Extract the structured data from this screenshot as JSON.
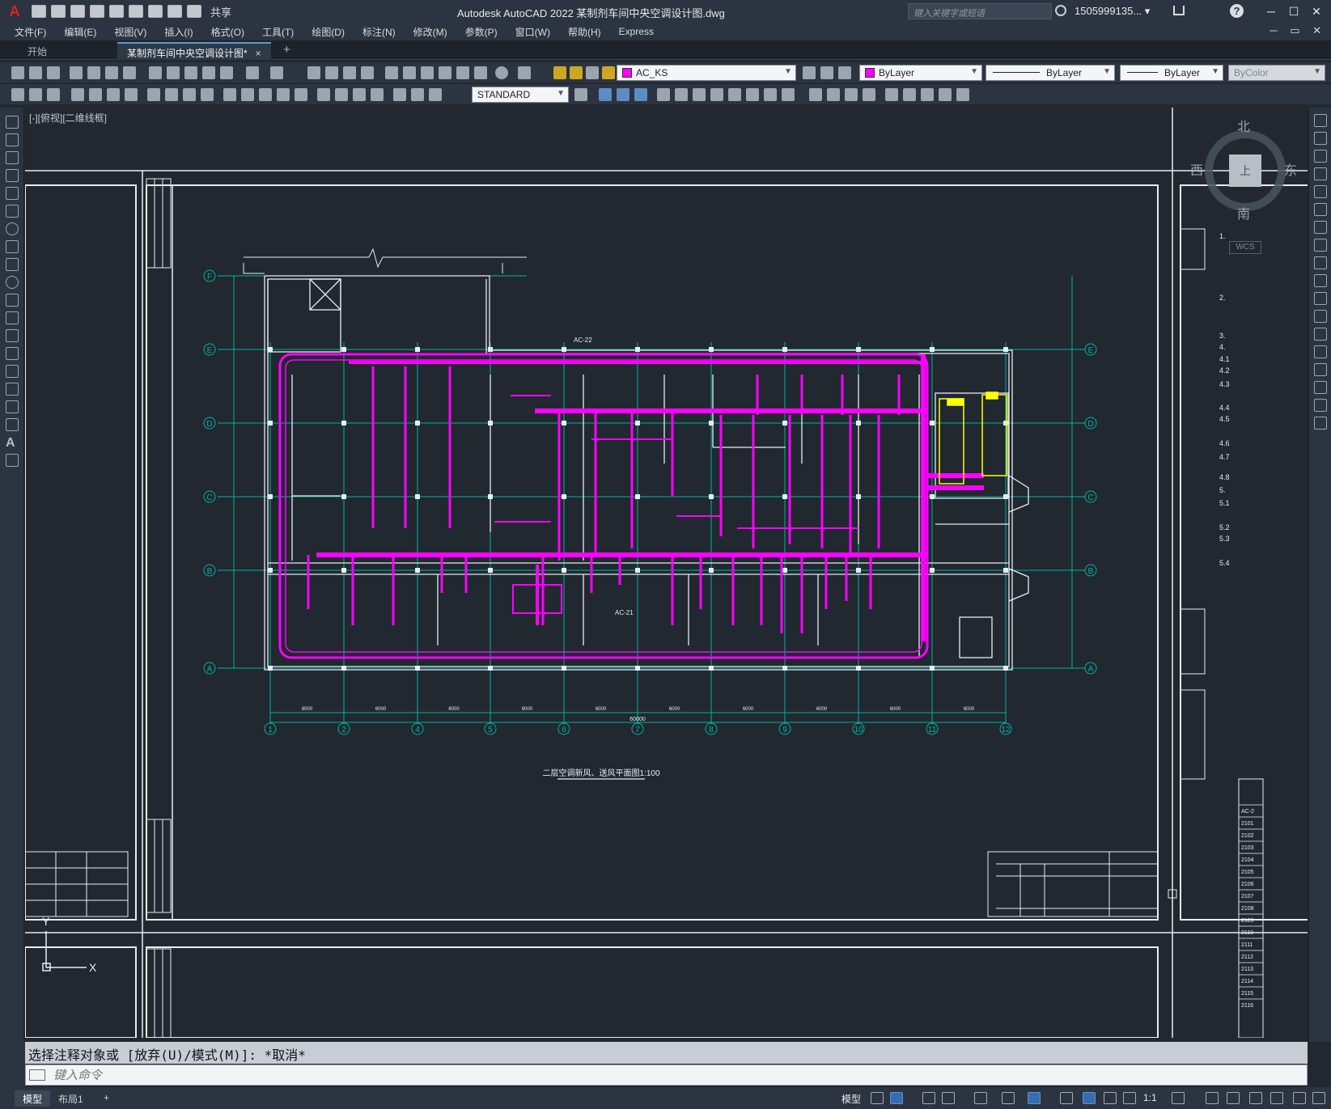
{
  "app": {
    "title": "Autodesk AutoCAD 2022    某制剂车间中央空调设计图.dwg",
    "logo": "A",
    "search_placeholder": "键入关键字或短语",
    "user": "1505999135...",
    "share_label": "共享"
  },
  "menu": {
    "items": [
      "文件(F)",
      "编辑(E)",
      "视图(V)",
      "插入(I)",
      "格式(O)",
      "工具(T)",
      "绘图(D)",
      "标注(N)",
      "修改(M)",
      "参数(P)",
      "窗口(W)",
      "帮助(H)",
      "Express"
    ]
  },
  "tabs": {
    "start": "开始",
    "active": "某制剂车间中央空调设计图*",
    "close": "×",
    "add": "+"
  },
  "toolbar": {
    "layer": "AC_KS",
    "color": "ByLayer",
    "linetype": "ByLayer",
    "lineweight": "ByLayer",
    "plotstyle": "ByColor",
    "textstyle": "STANDARD",
    "layer_color": "#ff00ff"
  },
  "viewport": {
    "label": "[-][俯视][二维线框]"
  },
  "viewcube": {
    "north": "北",
    "south": "南",
    "east": "东",
    "west": "西",
    "top": "上",
    "wcs": "WCS"
  },
  "drawing": {
    "grid_rows": [
      "F",
      "E",
      "D",
      "C",
      "B",
      "A"
    ],
    "grid_cols": [
      "1",
      "2",
      "4",
      "5",
      "6",
      "7",
      "8",
      "9",
      "10",
      "11",
      "12"
    ],
    "bay_dims": [
      "6000",
      "6000",
      "6000",
      "6000",
      "6000",
      "6000",
      "6000",
      "6000",
      "6000",
      "6000"
    ],
    "total_dim": "60000",
    "title": "二层空调新风、送风平面图1:100",
    "ac_labels": [
      "AC-22",
      "AC-21"
    ],
    "ucs_x": "X",
    "ucs_y": "Y"
  },
  "notes": {
    "items": [
      "1.",
      "2.",
      "3.",
      "4.",
      "4.1",
      "4.2",
      "4.3",
      "4.4",
      "4.5",
      "4.6",
      "4.7",
      "4.8",
      "5.",
      "5.1",
      "5.2",
      "5.3",
      "5.4"
    ]
  },
  "room_schedule": {
    "codes": [
      "AC-2",
      "2101",
      "2102",
      "2103",
      "2104",
      "2105",
      "2106",
      "2107",
      "2108",
      "2109",
      "2110",
      "2111",
      "2112",
      "2113",
      "2114",
      "2115",
      "2116"
    ]
  },
  "command": {
    "history": "选择注释对象或 [放弃(U)/模式(M)]: *取消*",
    "placeholder": "键入命令"
  },
  "status": {
    "model_tab": "模型",
    "layout_tab": "布局1",
    "add_tab": "+",
    "model_label": "模型",
    "scale": "1:1"
  }
}
